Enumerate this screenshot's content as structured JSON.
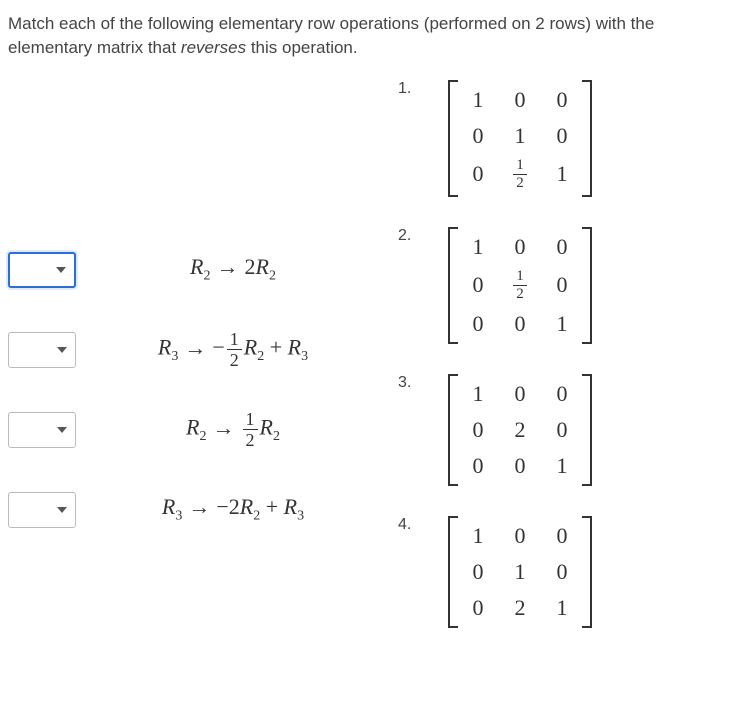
{
  "prompt_pre": "Match each of the following elementary row operations (performed on 2 rows) with the elementary matrix that ",
  "prompt_italic": "reverses",
  "prompt_post": " this operation.",
  "operations": {
    "op1": {
      "lhs_sym": "R",
      "lhs_sub": "2",
      "rhs_coef": "2",
      "rhs_sym": "R",
      "rhs_sub": "2"
    },
    "op2": {
      "lhs_sym": "R",
      "lhs_sub": "3",
      "neg": "−",
      "frac_num": "1",
      "frac_den": "2",
      "mid_sym": "R",
      "mid_sub": "2",
      "plus": " + ",
      "tail_sym": "R",
      "tail_sub": "3"
    },
    "op3": {
      "lhs_sym": "R",
      "lhs_sub": "2",
      "frac_num": "1",
      "frac_den": "2",
      "rhs_sym": "R",
      "rhs_sub": "2"
    },
    "op4": {
      "lhs_sym": "R",
      "lhs_sub": "3",
      "coef": "−2",
      "mid_sym": "R",
      "mid_sub": "2",
      "plus": " + ",
      "tail_sym": "R",
      "tail_sub": "3"
    }
  },
  "answers": {
    "a1": {
      "num": "1.",
      "m": [
        "1",
        "0",
        "0",
        "0",
        "1",
        "0",
        "0",
        "frac:1:2",
        "1"
      ]
    },
    "a2": {
      "num": "2.",
      "m": [
        "1",
        "0",
        "0",
        "0",
        "frac:1:2",
        "0",
        "0",
        "0",
        "1"
      ]
    },
    "a3": {
      "num": "3.",
      "m": [
        "1",
        "0",
        "0",
        "0",
        "2",
        "0",
        "0",
        "0",
        "1"
      ]
    },
    "a4": {
      "num": "4.",
      "m": [
        "1",
        "0",
        "0",
        "0",
        "1",
        "0",
        "0",
        "2",
        "1"
      ]
    }
  }
}
